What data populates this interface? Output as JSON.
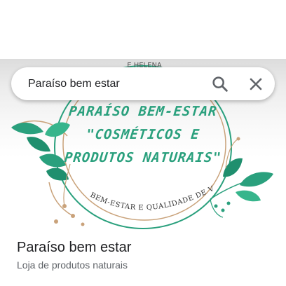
{
  "search": {
    "query": "Paraíso bem estar"
  },
  "icons": {
    "search": "search-icon",
    "close": "close-icon"
  },
  "photo": {
    "top_text": "E HELENA",
    "logo_line1": "PARAÍSO BEM-ESTAR",
    "logo_line2": "\"COSMÉTICOS E",
    "logo_line3": "PRODUTOS NATURAIS\"",
    "arc_text": "BEM-ESTAR E QUALIDADE DE VIDA"
  },
  "place": {
    "name": "Paraíso bem estar",
    "category": "Loja de produtos naturais"
  },
  "colors": {
    "brand_green": "#2aa07d",
    "leaf_dark": "#1f8f6e",
    "leaf_light": "#37b58c",
    "ring_gold": "#c9a27a",
    "text_primary": "#202124",
    "text_secondary": "#5f6368"
  }
}
